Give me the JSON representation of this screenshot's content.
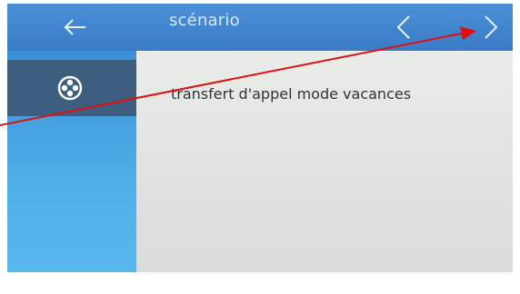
{
  "header": {
    "title": "scénario",
    "back_icon": "arrow-left-icon",
    "prev_icon": "chevron-left-icon",
    "next_icon": "chevron-right-icon"
  },
  "sidebar": {
    "items": [
      {
        "icon": "scenario-icon",
        "selected": true
      }
    ]
  },
  "main": {
    "items": [
      {
        "label": "transfert d'appel mode vacances"
      }
    ]
  },
  "annotation": {
    "type": "arrow",
    "color": "#e01010"
  },
  "colors": {
    "header": "#3f86cf",
    "sidebar": "#4aa6e2",
    "sidebar_selected": "#3d5e7e",
    "content_bg": "#e3e6e3"
  }
}
